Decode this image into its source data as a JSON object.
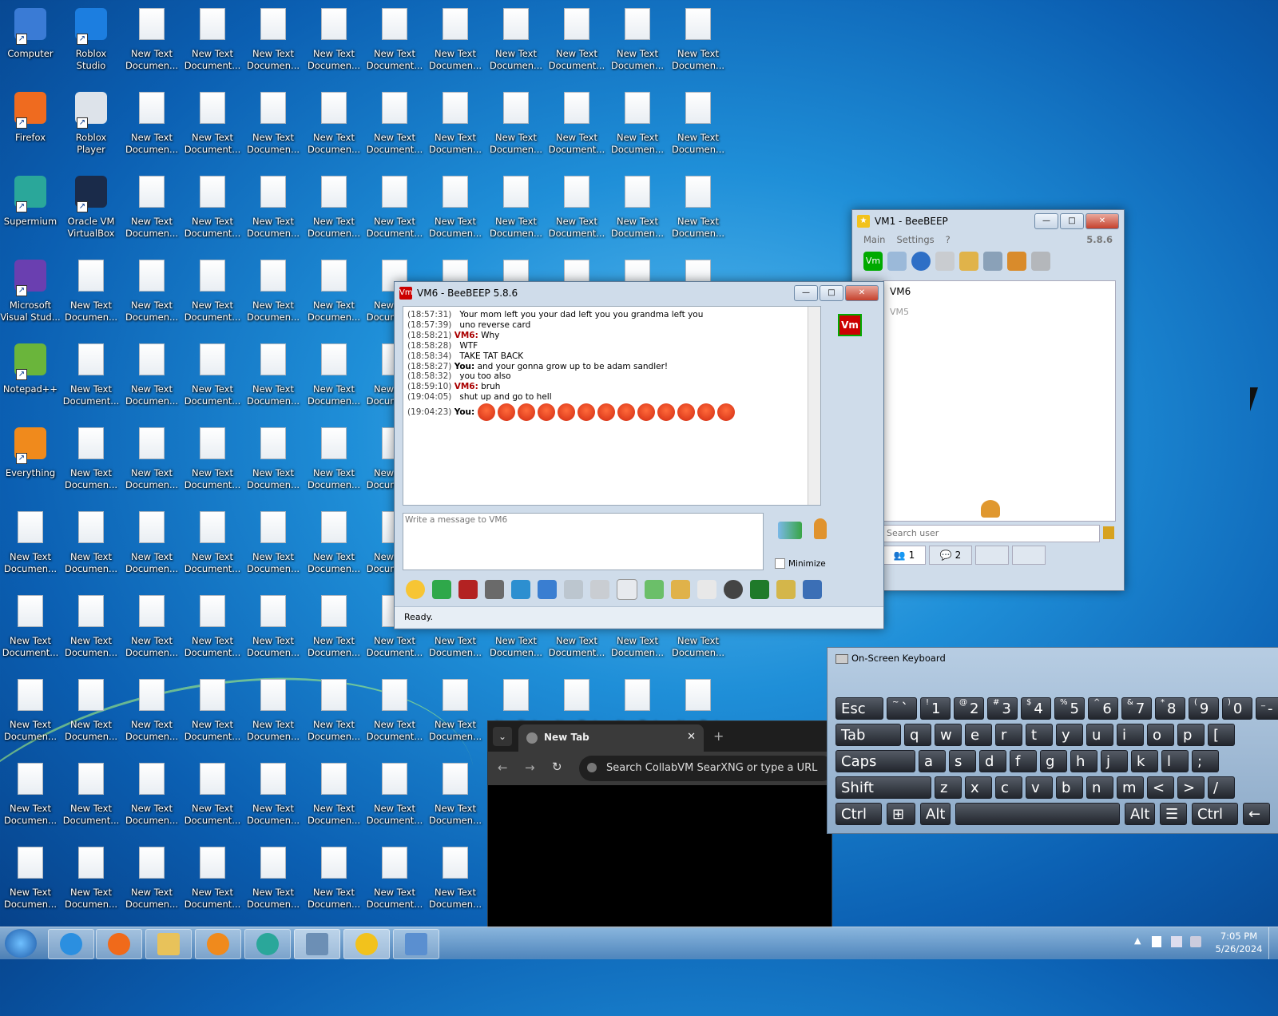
{
  "desktop": {
    "icons_col0": [
      "Computer",
      "Firefox",
      "Supermium",
      "Microsoft Visual Stud...",
      "Notepad++",
      "Everything",
      "New Text Documen...",
      "New Text Document...",
      "New Text Documen...",
      "New Text Documen...",
      "New Text Documen..."
    ],
    "icons_col1": [
      "Roblox Studio",
      "Roblox Player",
      "Oracle VM VirtualBox",
      "New Text Documen...",
      "New Text Document...",
      "New Text Documen...",
      "New Text Documen...",
      "New Text Documen...",
      "New Text Documen...",
      "New Text Document...",
      "New Text Documen..."
    ],
    "doc_label_a": "New Text Documen...",
    "doc_label_b": "New Text Document..."
  },
  "beebeep_main": {
    "title": "VM1 - BeeBEEP",
    "menu": [
      "Main",
      "Settings",
      "?"
    ],
    "version": "5.8.6",
    "users": [
      "VM6",
      "VM5"
    ],
    "search_placeholder": "Search user",
    "tabs": [
      "1",
      "2"
    ]
  },
  "chat_window": {
    "title": "VM6 - BeeBEEP 5.8.6",
    "avatar_text": "Vm",
    "messages": [
      {
        "time": "(18:57:31)",
        "sender": "",
        "text": "Your mom left you your dad left you you grandma left you"
      },
      {
        "time": "(18:57:39)",
        "sender": "",
        "text": "uno reverse card"
      },
      {
        "time": "(18:58:21)",
        "sender": "VM6:",
        "text": "Why"
      },
      {
        "time": "(18:58:28)",
        "sender": "",
        "text": "WTF"
      },
      {
        "time": "(18:58:34)",
        "sender": "",
        "text": "TAKE TAT BACK"
      },
      {
        "time": "(18:58:27)",
        "sender": "You:",
        "text": "and your gonna grow up to be adam sandler!"
      },
      {
        "time": "(18:58:32)",
        "sender": "",
        "text": "you too also"
      },
      {
        "time": "(18:59:10)",
        "sender": "VM6:",
        "text": "bruh"
      },
      {
        "time": "(19:04:05)",
        "sender": "",
        "text": "shut up and go to hell"
      }
    ],
    "last_time": "(19:04:23)",
    "last_sender": "You:",
    "emoji_count": 13,
    "input_placeholder": "Write a message to VM6",
    "minimize_label": "Minimize",
    "status": "Ready."
  },
  "osk": {
    "title": "On-Screen Keyboard",
    "row1": [
      {
        "l": "Esc"
      },
      {
        "s": "~",
        "l": "`"
      },
      {
        "s": "!",
        "l": "1"
      },
      {
        "s": "@",
        "l": "2"
      },
      {
        "s": "#",
        "l": "3"
      },
      {
        "s": "$",
        "l": "4"
      },
      {
        "s": "%",
        "l": "5"
      },
      {
        "s": "^",
        "l": "6"
      },
      {
        "s": "&",
        "l": "7"
      },
      {
        "s": "*",
        "l": "8"
      },
      {
        "s": "(",
        "l": "9"
      },
      {
        "s": ")",
        "l": "0"
      },
      {
        "s": "_",
        "l": "-"
      }
    ],
    "row2": [
      "Tab",
      "q",
      "w",
      "e",
      "r",
      "t",
      "y",
      "u",
      "i",
      "o",
      "p",
      "["
    ],
    "row3": [
      "Caps",
      "a",
      "s",
      "d",
      "f",
      "g",
      "h",
      "j",
      "k",
      "l",
      ";"
    ],
    "row4": [
      "Shift",
      "z",
      "x",
      "c",
      "v",
      "b",
      "n",
      "m",
      "<",
      ">",
      "/"
    ],
    "row5": [
      "Ctrl",
      "Alt",
      "Alt",
      "Ctrl"
    ]
  },
  "browser": {
    "tab_label": "New Tab",
    "address_placeholder": "Search CollabVM SearXNG or type a URL"
  },
  "taskbar": {
    "time": "7:05 PM",
    "date": "5/26/2024"
  }
}
